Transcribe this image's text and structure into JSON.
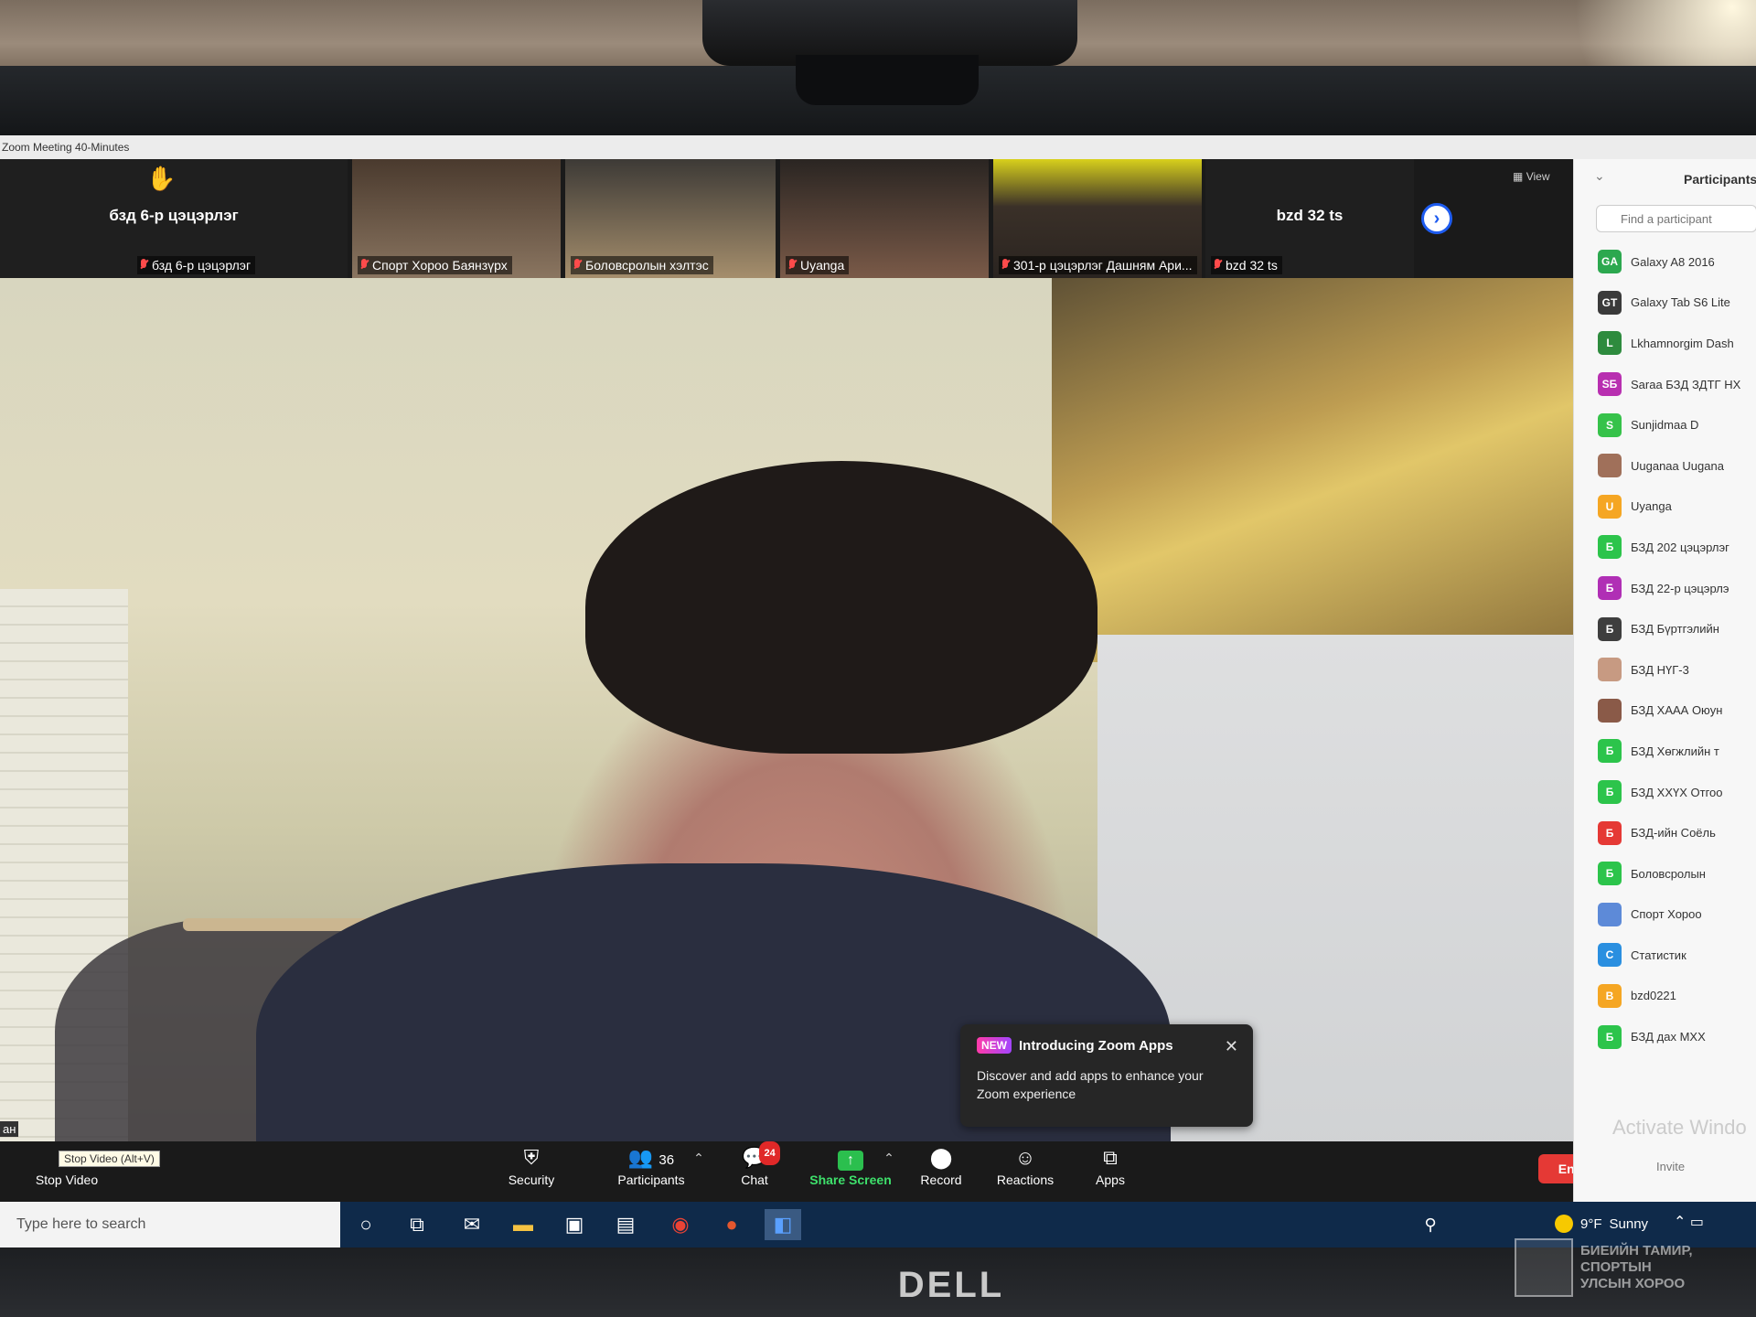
{
  "window": {
    "title": "Zoom Meeting 40-Minutes"
  },
  "gallery": {
    "view_label": "View",
    "tiles": [
      {
        "center_name": "бзд 6-р цэцэрлэг",
        "label": "бзд 6-р цэцэрлэг",
        "type": "name"
      },
      {
        "label": "Спорт Хороо Баянзүрх",
        "type": "video"
      },
      {
        "label": "Боловсролын хэлтэс",
        "type": "video"
      },
      {
        "label": "Uyanga",
        "type": "video"
      },
      {
        "label": "301-р цэцэрлэг Дашням Ари...",
        "type": "video"
      },
      {
        "center_name": "bzd 32 ts",
        "label": "bzd 32 ts",
        "type": "name"
      }
    ],
    "next_icon": "chevron-right-icon"
  },
  "popup": {
    "badge": "NEW",
    "title": "Introducing Zoom Apps",
    "body": "Discover and add apps to enhance your Zoom experience",
    "close_glyph": "✕"
  },
  "toolbar": {
    "stop_video_label": "Stop Video",
    "stop_video_tooltip": "Stop Video (Alt+V)",
    "security_label": "Security",
    "participants_label": "Participants",
    "participants_count": "36",
    "chat_label": "Chat",
    "chat_badge": "24",
    "share_label": "Share Screen",
    "record_label": "Record",
    "reactions_label": "Reactions",
    "apps_label": "Apps",
    "end_label": "End",
    "left_fragment": "ан"
  },
  "participants_panel": {
    "title": "Participants",
    "search_placeholder": "Find a participant",
    "items": [
      {
        "initials": "GA",
        "name": "Galaxy A8 2016",
        "color": "#2ca84f"
      },
      {
        "initials": "GT",
        "name": "Galaxy Tab S6 Lite",
        "color": "#3a3a3a"
      },
      {
        "initials": "L",
        "name": "Lkhamnorgim Dash",
        "color": "#2e8b3e"
      },
      {
        "initials": "SБ",
        "name": "Saraa БЗД ЗДТГ НХ",
        "color": "#b82fb0"
      },
      {
        "initials": "S",
        "name": "Sunjidmaa D",
        "color": "#36c24a"
      },
      {
        "initials": "",
        "name": "Uuganaa Uugana",
        "color": "#a0705a"
      },
      {
        "initials": "U",
        "name": "Uyanga",
        "color": "#f5a623"
      },
      {
        "initials": "Б",
        "name": "БЗД 202 цэцэрлэг",
        "color": "#2cc44b"
      },
      {
        "initials": "Б",
        "name": "БЗД 22-р цэцэрлэ",
        "color": "#b02fb5"
      },
      {
        "initials": "Б",
        "name": "БЗД Бүртгэлийн",
        "color": "#3e3e3e"
      },
      {
        "initials": "",
        "name": "БЗД НҮГ-3",
        "color": "#c79a82"
      },
      {
        "initials": "",
        "name": "БЗД ХААА Оюун",
        "color": "#8a5a48"
      },
      {
        "initials": "Б",
        "name": "БЗД Хөгжлийн т",
        "color": "#2cc44b"
      },
      {
        "initials": "Б",
        "name": "БЗД ХХҮХ Отгоо",
        "color": "#2cc44b"
      },
      {
        "initials": "Б",
        "name": "БЗД-ийн Соёль",
        "color": "#e53935"
      },
      {
        "initials": "Б",
        "name": "Боловсролын",
        "color": "#2cc44b"
      },
      {
        "initials": "",
        "name": "Спорт Хороо",
        "color": "#5d8ad8"
      },
      {
        "initials": "С",
        "name": "Статистик",
        "color": "#2a8fe0"
      },
      {
        "initials": "B",
        "name": "bzd0221",
        "color": "#f5a623"
      },
      {
        "initials": "Б",
        "name": "БЗД дах МХХ",
        "color": "#2cc44b"
      }
    ],
    "invite_label": "Invite",
    "activate_text": "Activate Windo"
  },
  "taskbar": {
    "search_placeholder": "Type here to search",
    "weather_temp": "9°F",
    "weather_text": "Sunny"
  },
  "monitor": {
    "brand": "DELL",
    "watermark_line1": "БИЕИЙН ТАМИР, СПОРТЫН",
    "watermark_line2": "УЛСЫН ХОРОО"
  }
}
